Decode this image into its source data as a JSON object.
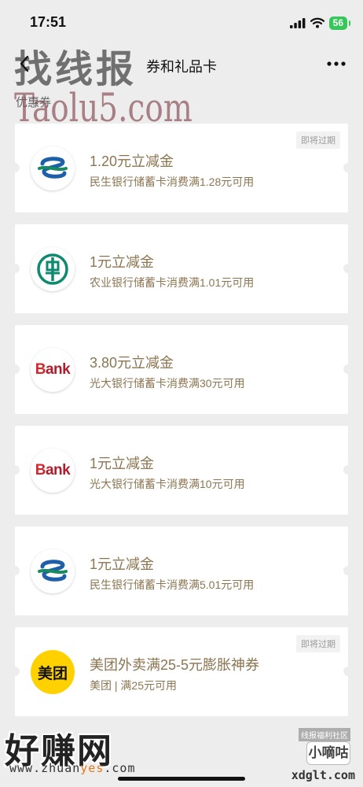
{
  "status_bar": {
    "time": "17:51",
    "battery": "56"
  },
  "nav": {
    "title": "券和礼品卡"
  },
  "section": {
    "label": "优惠券"
  },
  "coupons": [
    {
      "title": "1.20元立减金",
      "subtitle": "民生银行储蓄卡消费满1.28元可用",
      "badge": "即将过期",
      "logo": "cmbc-logo"
    },
    {
      "title": "1元立减金",
      "subtitle": "农业银行储蓄卡消费满1.01元可用",
      "badge": "",
      "logo": "abc-logo"
    },
    {
      "title": "3.80元立减金",
      "subtitle": "光大银行储蓄卡消费满30元可用",
      "badge": "",
      "logo": "cebbank-logo",
      "logo_text": "Bank"
    },
    {
      "title": "1元立减金",
      "subtitle": "光大银行储蓄卡消费满10元可用",
      "badge": "",
      "logo": "cebbank-logo",
      "logo_text": "Bank"
    },
    {
      "title": "1元立减金",
      "subtitle": "民生银行储蓄卡消费满5.01元可用",
      "badge": "",
      "logo": "cmbc-logo"
    },
    {
      "title": "美团外卖满25-5元膨胀神券",
      "subtitle": "美团 | 满25元可用",
      "badge": "即将过期",
      "logo": "meituan-logo",
      "logo_text": "美团"
    }
  ],
  "watermarks": {
    "top": "找线报",
    "taolu": "Taolu5.com",
    "haozhuan": "好赚网",
    "url_prefix": "www.zhuan",
    "url_highlight": "yes",
    "url_suffix": ".com",
    "community": "线报福利社区",
    "xiaodigu": "小嘀咕",
    "xdglt": "xdglt.com"
  },
  "colors": {
    "coupon_text": "#8c7551",
    "background": "#ededed",
    "meituan_yellow": "#ffd100",
    "abc_green": "#0e8a6f",
    "cmbc_green": "#1a8a60",
    "cmbc_blue": "#1d5fa8"
  }
}
